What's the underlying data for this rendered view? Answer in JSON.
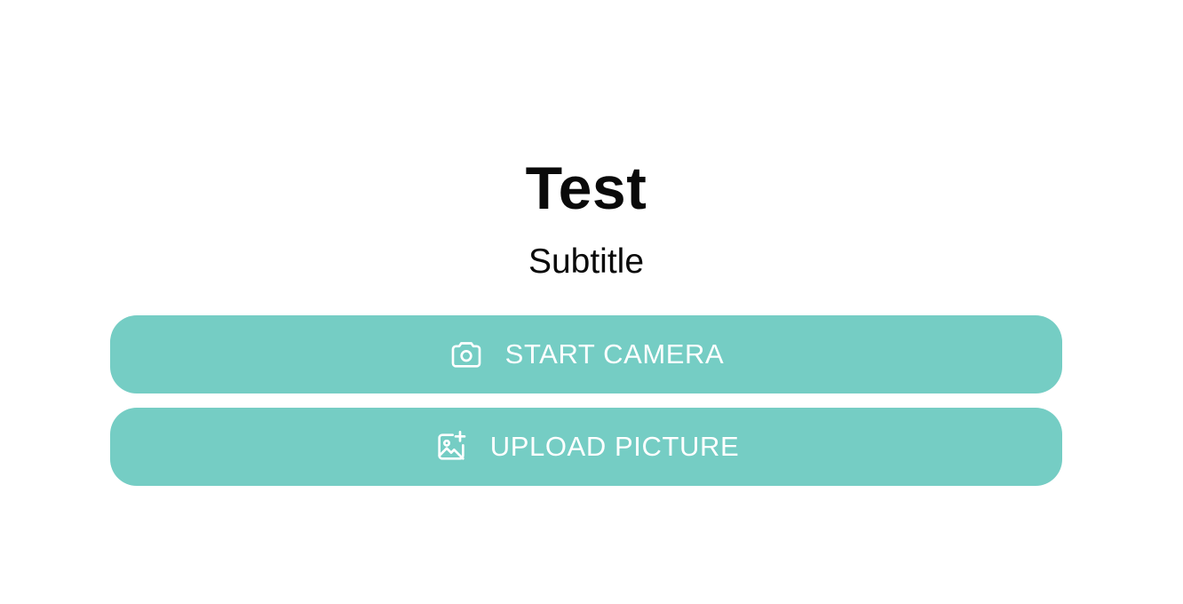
{
  "colors": {
    "accent": "#75cdc4",
    "background": "#ffffff",
    "text": "#0a0a0a",
    "button_text": "#ffffff"
  },
  "header": {
    "title": "Test",
    "subtitle": "Subtitle"
  },
  "actions": {
    "start_camera": {
      "label": "START CAMERA",
      "icon": "camera-icon"
    },
    "upload_picture": {
      "label": "UPLOAD PICTURE",
      "icon": "image-plus-icon"
    }
  }
}
